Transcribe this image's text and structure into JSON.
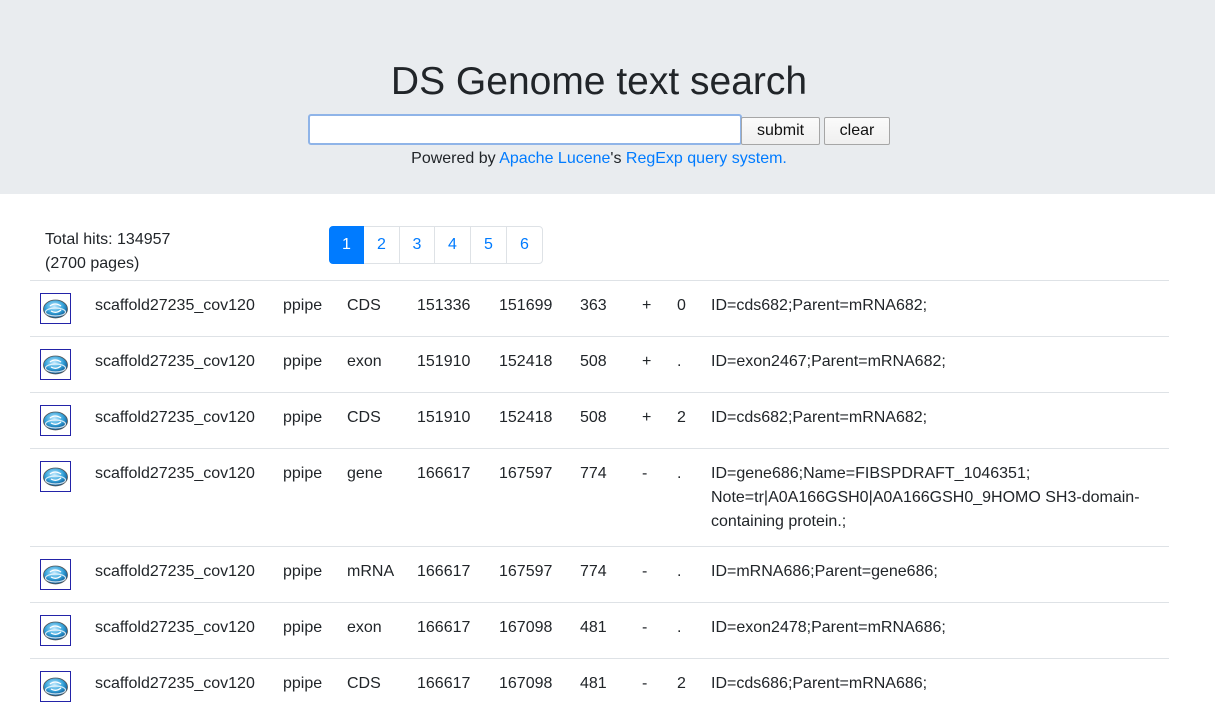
{
  "header": {
    "title": "DS Genome text search",
    "search": {
      "value": "",
      "placeholder": ""
    },
    "submit_label": "submit",
    "clear_label": "clear",
    "powered_prefix": "Powered by ",
    "powered_link1": "Apache Lucene",
    "powered_mid": "'s ",
    "powered_link2": "RegExp query system."
  },
  "summary": {
    "hits_line": "Total hits: 134957",
    "pages_line": "(2700 pages)"
  },
  "pagination": [
    "1",
    "2",
    "3",
    "4",
    "5",
    "6"
  ],
  "active_page": "1",
  "rows": [
    {
      "seq": "scaffold27235_cov120",
      "source": "ppipe",
      "type": "CDS",
      "start": "151336",
      "end": "151699",
      "length": "363",
      "strand": "+",
      "phase": "0",
      "attr": "ID=cds682;Parent=mRNA682;"
    },
    {
      "seq": "scaffold27235_cov120",
      "source": "ppipe",
      "type": "exon",
      "start": "151910",
      "end": "152418",
      "length": "508",
      "strand": "+",
      "phase": ".",
      "attr": "ID=exon2467;Parent=mRNA682;"
    },
    {
      "seq": "scaffold27235_cov120",
      "source": "ppipe",
      "type": "CDS",
      "start": "151910",
      "end": "152418",
      "length": "508",
      "strand": "+",
      "phase": "2",
      "attr": "ID=cds682;Parent=mRNA682;"
    },
    {
      "seq": "scaffold27235_cov120",
      "source": "ppipe",
      "type": "gene",
      "start": "166617",
      "end": "167597",
      "length": "774",
      "strand": "-",
      "phase": ".",
      "attr": "ID=gene686;Name=FIBSPDRAFT_1046351; Note=tr|A0A166GSH0|A0A166GSH0_9HOMO SH3-domain-containing protein.;"
    },
    {
      "seq": "scaffold27235_cov120",
      "source": "ppipe",
      "type": "mRNA",
      "start": "166617",
      "end": "167597",
      "length": "774",
      "strand": "-",
      "phase": ".",
      "attr": "ID=mRNA686;Parent=gene686;"
    },
    {
      "seq": "scaffold27235_cov120",
      "source": "ppipe",
      "type": "exon",
      "start": "166617",
      "end": "167098",
      "length": "481",
      "strand": "-",
      "phase": ".",
      "attr": "ID=exon2478;Parent=mRNA686;"
    },
    {
      "seq": "scaffold27235_cov120",
      "source": "ppipe",
      "type": "CDS",
      "start": "166617",
      "end": "167098",
      "length": "481",
      "strand": "-",
      "phase": "2",
      "attr": "ID=cds686;Parent=mRNA686;"
    }
  ],
  "icons": {
    "row_icon": "genome-browser-icon"
  },
  "colors": {
    "accent": "#007bff",
    "header_bg": "#e9ecef",
    "border": "#dee2e6"
  }
}
